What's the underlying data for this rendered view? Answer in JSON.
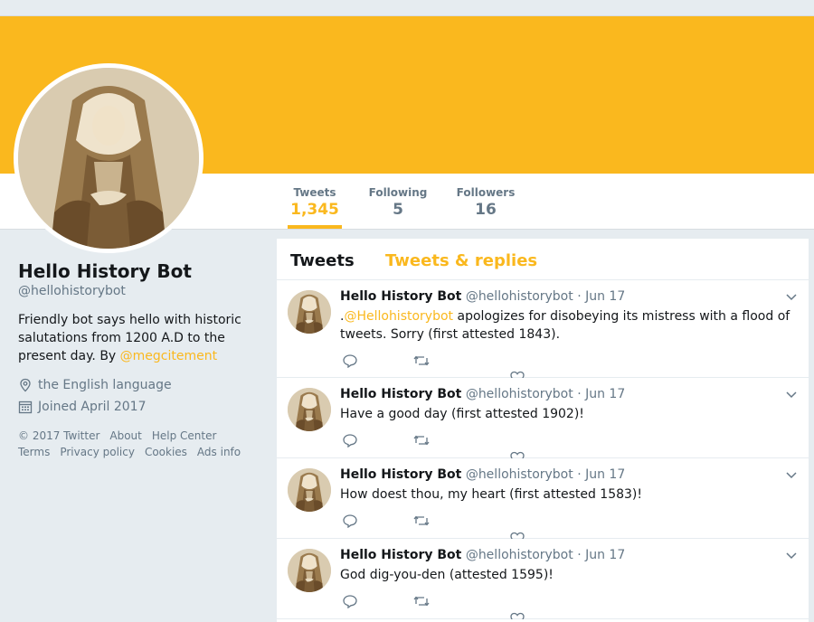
{
  "colors": {
    "accent": "#fab81e",
    "muted": "#657786",
    "text": "#14171a"
  },
  "stats": [
    {
      "label": "Tweets",
      "value": "1,345"
    },
    {
      "label": "Following",
      "value": "5"
    },
    {
      "label": "Followers",
      "value": "16"
    }
  ],
  "profile": {
    "name": "Hello History Bot",
    "handle": "@hellohistorybot",
    "bio": "Friendly bot says hello with historic salutations from 1200 A.D to the present day. By ",
    "bio_link": "@megcitement",
    "location": "the English language",
    "joined": "Joined April 2017"
  },
  "footer": {
    "items": [
      "© 2017 Twitter",
      "About",
      "Help Center",
      "Terms",
      "Privacy policy",
      "Cookies",
      "Ads info"
    ]
  },
  "tabs": {
    "tweets": "Tweets",
    "replies": "Tweets & replies"
  },
  "tweets": [
    {
      "name": "Hello History Bot",
      "handle": "@hellohistorybot",
      "date": "· Jun 17",
      "prefix": ".",
      "mention": "@Hellohistorybot",
      "text": " apologizes for disobeying its mistress with a flood of tweets. Sorry (first attested 1843)."
    },
    {
      "name": "Hello History Bot",
      "handle": "@hellohistorybot",
      "date": "· Jun 17",
      "text": "Have a good day (first attested 1902)!"
    },
    {
      "name": "Hello History Bot",
      "handle": "@hellohistorybot",
      "date": "· Jun 17",
      "text": "How doest thou, my heart (first attested 1583)!"
    },
    {
      "name": "Hello History Bot",
      "handle": "@hellohistorybot",
      "date": "· Jun 17",
      "text": "God dig-you-den (attested 1595)!"
    }
  ],
  "icons": {
    "location": "location-pin-icon",
    "calendar": "calendar-icon",
    "reply": "reply-icon",
    "retweet": "retweet-icon",
    "like": "heart-icon",
    "caret": "chevron-down-icon"
  }
}
